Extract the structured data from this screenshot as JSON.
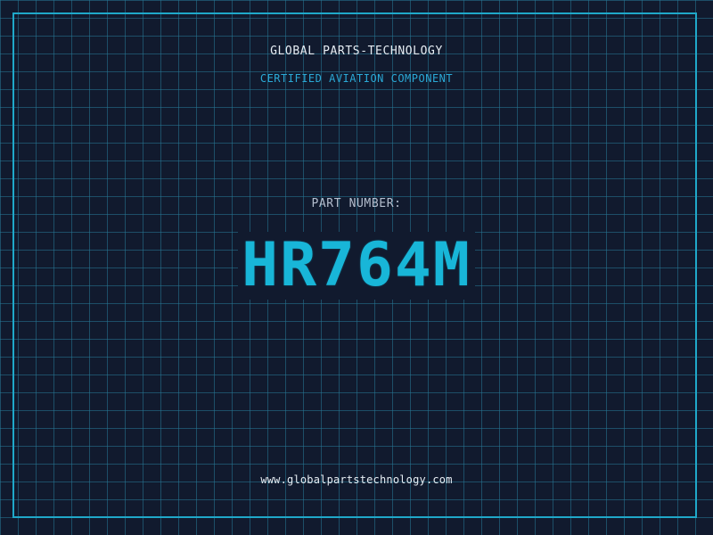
{
  "header": {
    "company": "GLOBAL PARTS-TECHNOLOGY",
    "subtitle": "CERTIFIED AVIATION COMPONENT"
  },
  "part": {
    "label": "PART NUMBER:",
    "number": "HR764M"
  },
  "footer": {
    "website": "www.globalpartstechnology.com"
  },
  "colors": {
    "background": "#111a2e",
    "grid": "#267896",
    "accent": "#18b6d8",
    "text": "#e6edf3"
  }
}
